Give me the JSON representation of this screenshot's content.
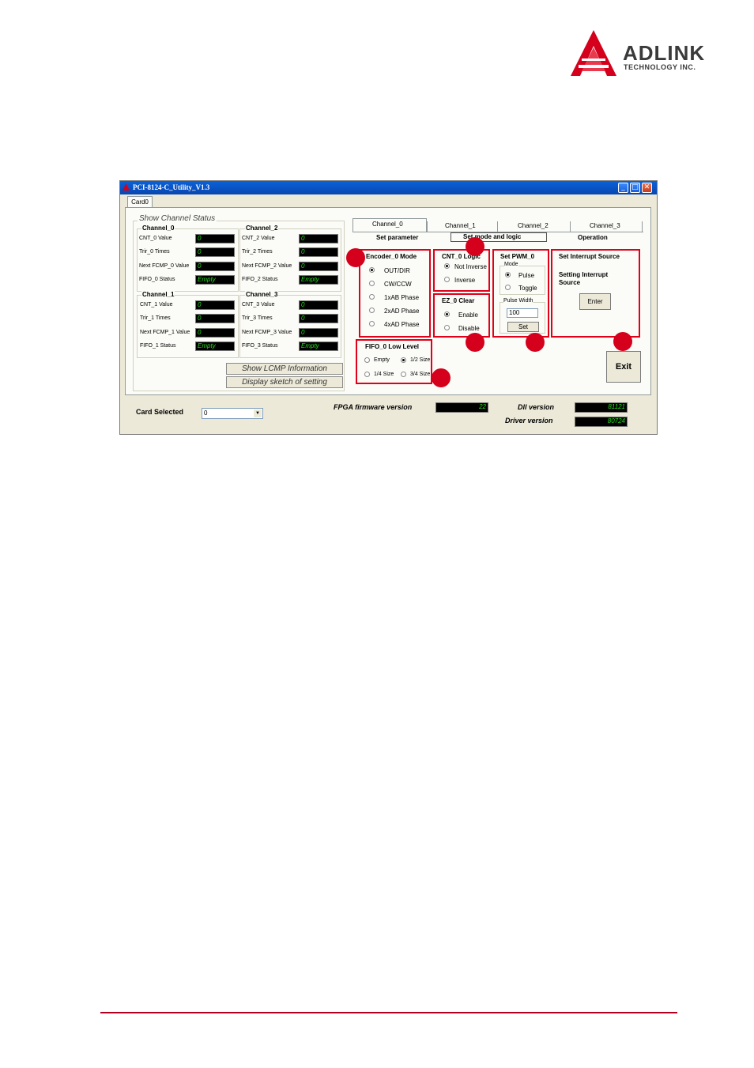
{
  "brand": {
    "name": "ADLINK",
    "tagline": "TECHNOLOGY INC.",
    "color": "#d4001c"
  },
  "window": {
    "title": "PCI-8124-C_Utility_V1.3",
    "tab": "Card0"
  },
  "channel_status": {
    "title": "Show Channel Status",
    "channels": [
      {
        "name": "Channel_0",
        "rows": [
          {
            "label": "CNT_0 Value",
            "value": "0"
          },
          {
            "label": "Trir_0 Times",
            "value": "0"
          },
          {
            "label": "Next FCMP_0 Value",
            "value": "0"
          },
          {
            "label": "FIFO_0 Status",
            "value": "Empty"
          }
        ]
      },
      {
        "name": "Channel_2",
        "rows": [
          {
            "label": "CNT_2 Value",
            "value": "0"
          },
          {
            "label": "Trir_2 Times",
            "value": "0"
          },
          {
            "label": "Next FCMP_2 Value",
            "value": "0"
          },
          {
            "label": "FIFO_2 Status",
            "value": "Empty"
          }
        ]
      },
      {
        "name": "Channel_1",
        "rows": [
          {
            "label": "CNT_1 Value",
            "value": "0"
          },
          {
            "label": "Trir_1 Times",
            "value": "0"
          },
          {
            "label": "Next FCMP_1 Value",
            "value": "0"
          },
          {
            "label": "FIFO_1 Status",
            "value": "Empty"
          }
        ]
      },
      {
        "name": "Channel_3",
        "rows": [
          {
            "label": "CNT_3 Value",
            "value": "0"
          },
          {
            "label": "Trir_3 Times",
            "value": "0"
          },
          {
            "label": "Next FCMP_3 Value",
            "value": "0"
          },
          {
            "label": "FIFO_3 Status",
            "value": "Empty"
          }
        ]
      }
    ],
    "show_lcmp_button": "Show  LCMP  Information",
    "display_sketch_button": "Display sketch  of  setting"
  },
  "channel_tabs": [
    "Channel_0",
    "Channel_1",
    "Channel_2",
    "Channel_3"
  ],
  "param_tabs": [
    "Set parameter",
    "Set mode and logic",
    "Operation"
  ],
  "encoder": {
    "title": "Encoder_0 Mode",
    "options": [
      "OUT/DIR",
      "CW/CCW",
      "1xAB Phase",
      "2xAD Phase",
      "4xAD Phase"
    ],
    "selected": 0
  },
  "cnt": {
    "title": "CNT_0 Logic",
    "options": [
      "Not Inverse",
      "Inverse"
    ],
    "selected": 0
  },
  "ez": {
    "title": "EZ_0 Clear",
    "options": [
      "Enable",
      "Disable"
    ],
    "selected": 0
  },
  "pwm": {
    "title": "Set PWM_0",
    "mode_label": "Mode",
    "mode_options": [
      "Pulse",
      "Toggle"
    ],
    "selected": 0,
    "pulse_width_label": "Pulse Width",
    "pulse_width_value": "100",
    "set_button": "Set"
  },
  "interrupt": {
    "title": "Set Interrupt Source",
    "subtitle": "Setting Interrupt Source",
    "enter_button": "Enter"
  },
  "fifo": {
    "title": "FIFO_0 Low Level",
    "options": [
      "Empty",
      "1/2 Size",
      "1/4 Size",
      "3/4 Size"
    ],
    "selected": 1
  },
  "exit_button": "Exit",
  "bottom": {
    "card_selected_label": "Card Selected",
    "card_selected_value": "0",
    "fpga_label": "FPGA firmware version",
    "fpga_value": "22",
    "dll_label": "Dll version",
    "dll_value": "81121",
    "driver_label": "Driver version",
    "driver_value": "80724"
  },
  "callouts": {
    "color": "#e0001a"
  }
}
